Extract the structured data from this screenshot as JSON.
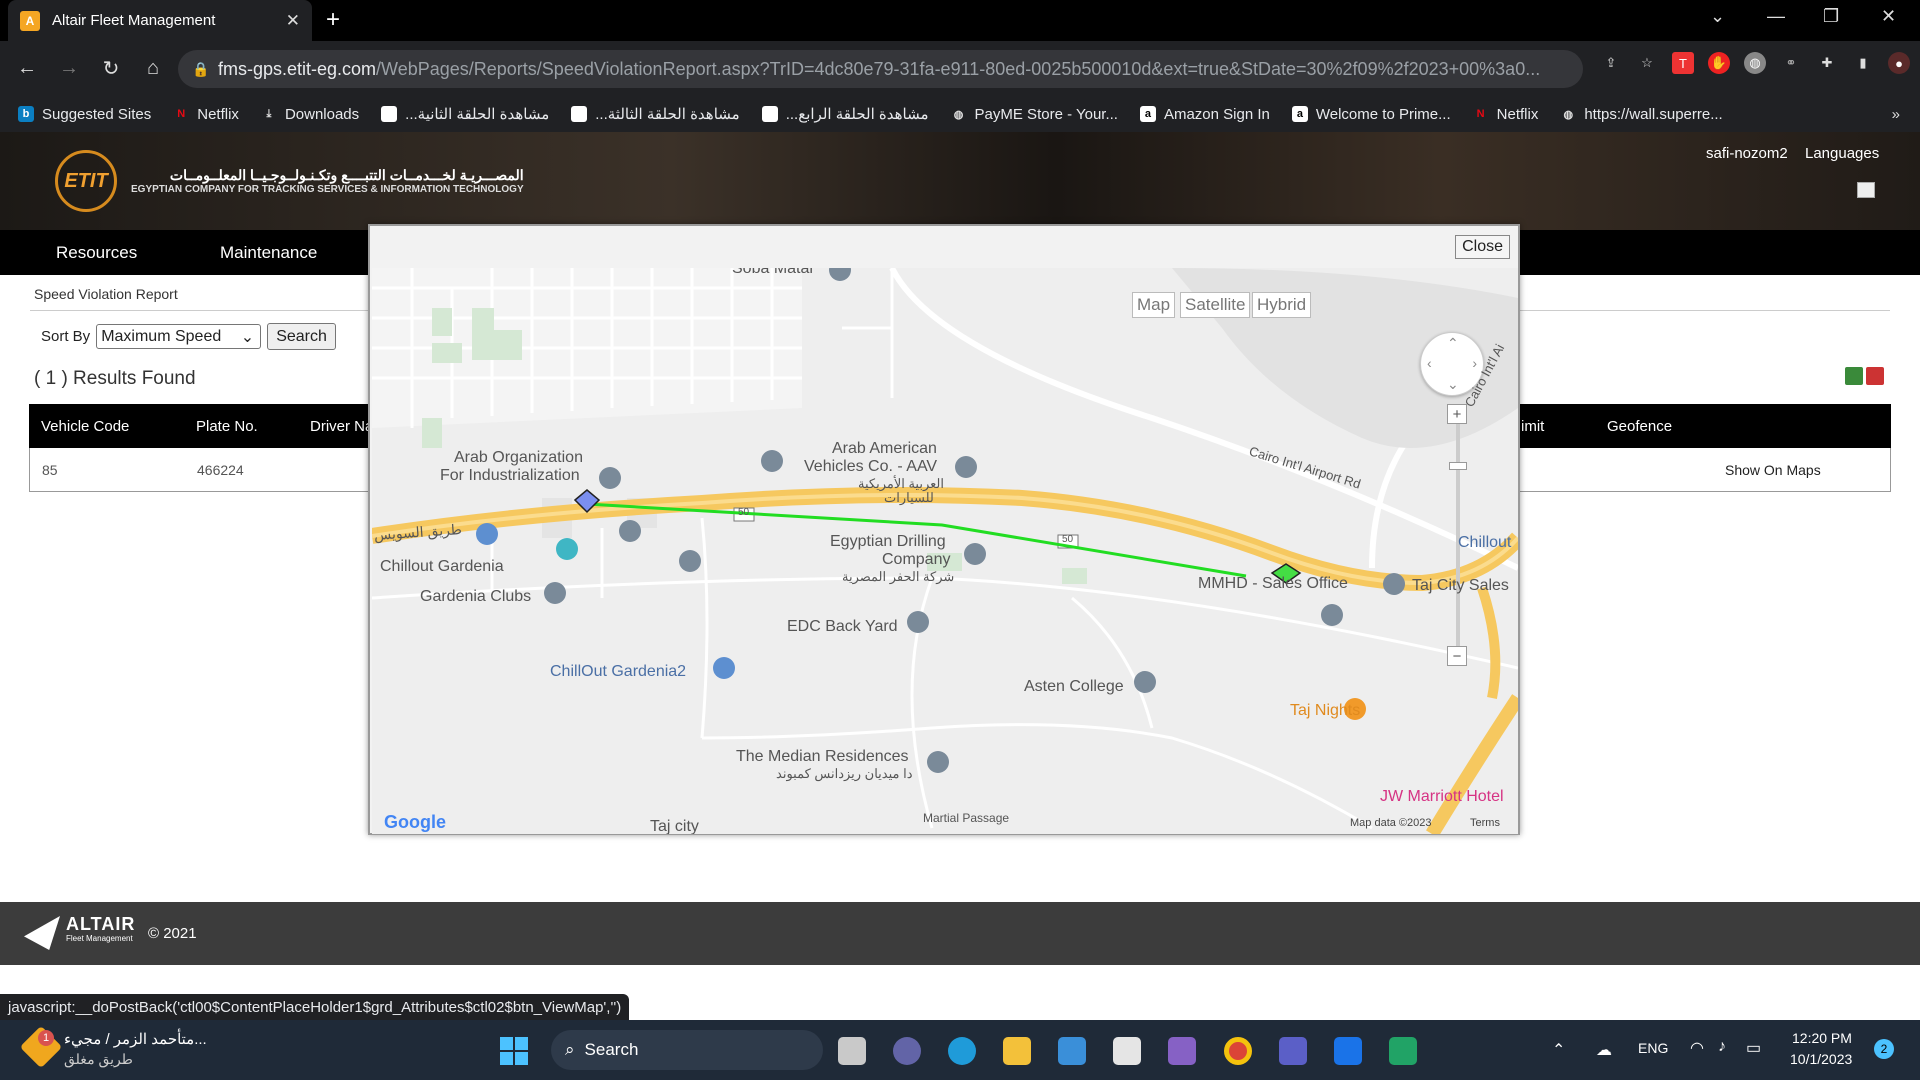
{
  "browser": {
    "tab_title": "Altair Fleet Management",
    "url_host": "fms-gps.etit-eg.com",
    "url_path": "/WebPages/Reports/SpeedViolationReport.aspx?TrID=4dc80e79-31fa-e911-80ed-0025b500010d&ext=true&StDate=30%2f09%2f2023+00%3a0...",
    "bookmarks": [
      "Suggested Sites",
      "Netflix",
      "Downloads",
      "...مشاهدة الحلقة الثانية",
      "...مشاهدة الحلقة الثالثة",
      "...مشاهدة الحلقة الرابع",
      "PayME Store - Your...",
      "Amazon Sign In",
      "Welcome to Prime...",
      "Netflix",
      "https://wall.superre..."
    ]
  },
  "header": {
    "logo_ar": "المصـــريـة لخـــدمــات التتبــــع وتكـنـولــوجـيــا المعلــومــات",
    "logo_en": "EGYPTIAN COMPANY FOR TRACKING SERVICES & INFORMATION TECHNOLOGY",
    "logo_abbr": "ETIT",
    "username": "safi-nozom2",
    "languages": "Languages"
  },
  "menu": {
    "items": [
      "Resources",
      "Maintenance"
    ]
  },
  "report": {
    "breadcrumb": "Speed Violation Report",
    "sort_label": "Sort By",
    "sort_value": "Maximum Speed",
    "search_label": "Search",
    "results": "( 1 ) Results Found",
    "columns": [
      "Vehicle Code",
      "Plate No.",
      "Driver Na",
      "imit",
      "Geofence"
    ],
    "row": {
      "vehicle_code": "85",
      "plate_no": "466224",
      "action": "Show On Maps"
    }
  },
  "modal": {
    "close_label": "Close",
    "map_types": [
      "Map",
      "Satellite",
      "Hybrid"
    ],
    "labels": [
      "Soba Matar",
      "Arab Organization",
      "For Industrialization",
      "Arab American",
      "Vehicles Co. - AAV",
      "العربية الأمريكية",
      "للسيارات",
      "Egyptian Drilling",
      "Company",
      "شركة الحفر المصرية",
      "Chillout Gardenia",
      "Gardenia Clubs",
      "EDC Back Yard",
      "ChillOut Gardenia2",
      "Asten College",
      "The Median Residences",
      "دا ميديان ريزدانس كمبوند",
      "Martial Passage",
      "Taj city",
      "MMHD - Sales Office",
      "Taj City Sales",
      "Chillout",
      "Taj Nights",
      "JW Marriott Hotel",
      "Cairo Int'l Airport Rd",
      "Cairo Int'l Ai",
      "طريق السويس",
      "50",
      "50",
      "Google",
      "Map data ©2023",
      "Terms"
    ]
  },
  "footer": {
    "brand": "ALTAIR",
    "brand_sub": "Fleet Management",
    "copyright": "© 2021"
  },
  "status_url": "javascript:__doPostBack('ctl00$ContentPlaceHolder1$grd_Attributes$ctl02$btn_ViewMap','')",
  "taskbar": {
    "notify_title": "متأحمد الزمر / مجيء...",
    "notify_sub": "طريق مغلق",
    "notify_badge": "1",
    "search": "Search",
    "lang": "ENG",
    "time": "12:20 PM",
    "date": "10/1/2023",
    "notif_count": "2"
  },
  "colors": {
    "route": "#22dd22",
    "road": "#f6c85f",
    "accent": "#d68b1e"
  }
}
